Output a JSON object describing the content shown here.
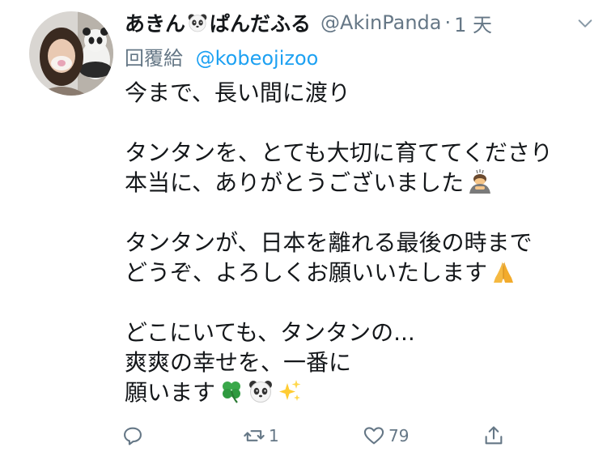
{
  "tweet": {
    "display_name": "あきん",
    "display_name_2": "ぱんだふる",
    "handle": "@AkinPanda",
    "separator": "·",
    "time": "1 天",
    "reply_label": "回覆給",
    "reply_user": "@kobeojizoo",
    "lines": [
      "今まで、長い間に渡り",
      "",
      "タンタンを、とても大切に育ててくださり",
      "本当に、ありがとうございました",
      "",
      "タンタンが、日本を離れる最後の時まで",
      "どうぞ、よろしくお願いいたします",
      "",
      "どこにいても、タンタンの...",
      "爽爽の幸せを、一番に",
      "願います"
    ],
    "emojis": {
      "name": "panda-face",
      "line4": "person-bowing",
      "line7": "folded-hands",
      "line11": [
        "four-leaf-clover",
        "panda-face",
        "sparkles"
      ]
    }
  },
  "actions": {
    "reply_count": "",
    "retweet_count": "1",
    "like_count": "79"
  },
  "colors": {
    "text": "#14171a",
    "secondary": "#657786",
    "link": "#1da1f2"
  }
}
